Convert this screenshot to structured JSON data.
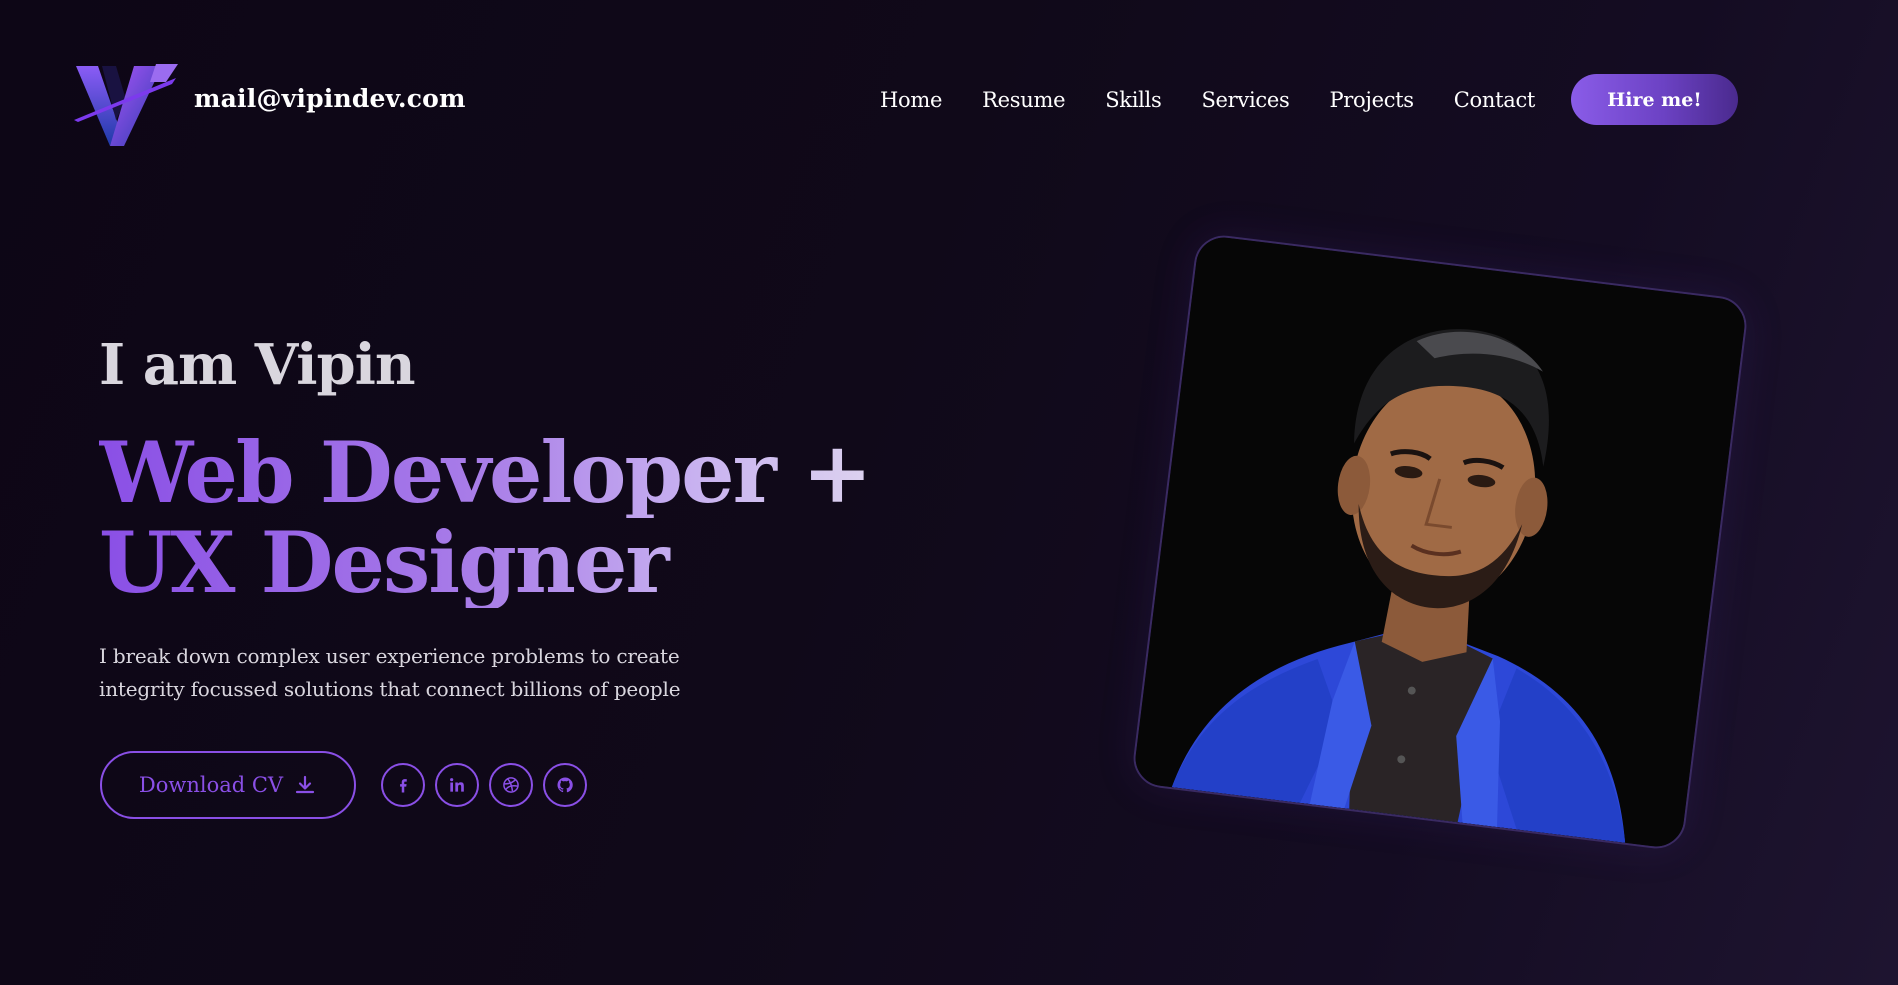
{
  "header": {
    "logo_icon": "v-logo-icon",
    "email": "mail@vipindev.com",
    "nav": [
      {
        "label": "Home"
      },
      {
        "label": "Resume"
      },
      {
        "label": "Skills"
      },
      {
        "label": "Services"
      },
      {
        "label": "Projects"
      },
      {
        "label": "Contact"
      }
    ],
    "hire_label": "Hire me!"
  },
  "hero": {
    "intro": "I am Vipin",
    "role_line_1": "Web Developer +",
    "role_line_2": "UX Designer",
    "description_line_1": "I break down complex user experience problems to create",
    "description_line_2": "integrity focussed solutions that connect billions of people",
    "download_label": "Download CV",
    "download_icon": "download-icon",
    "socials": [
      {
        "icon": "facebook-icon"
      },
      {
        "icon": "linkedin-icon"
      },
      {
        "icon": "dribbble-icon"
      },
      {
        "icon": "github-icon"
      }
    ]
  },
  "colors": {
    "background": "#0d0616",
    "accent": "#8a4fe6",
    "accent_light": "#c9b3f0",
    "text_muted": "#d9d6de"
  }
}
